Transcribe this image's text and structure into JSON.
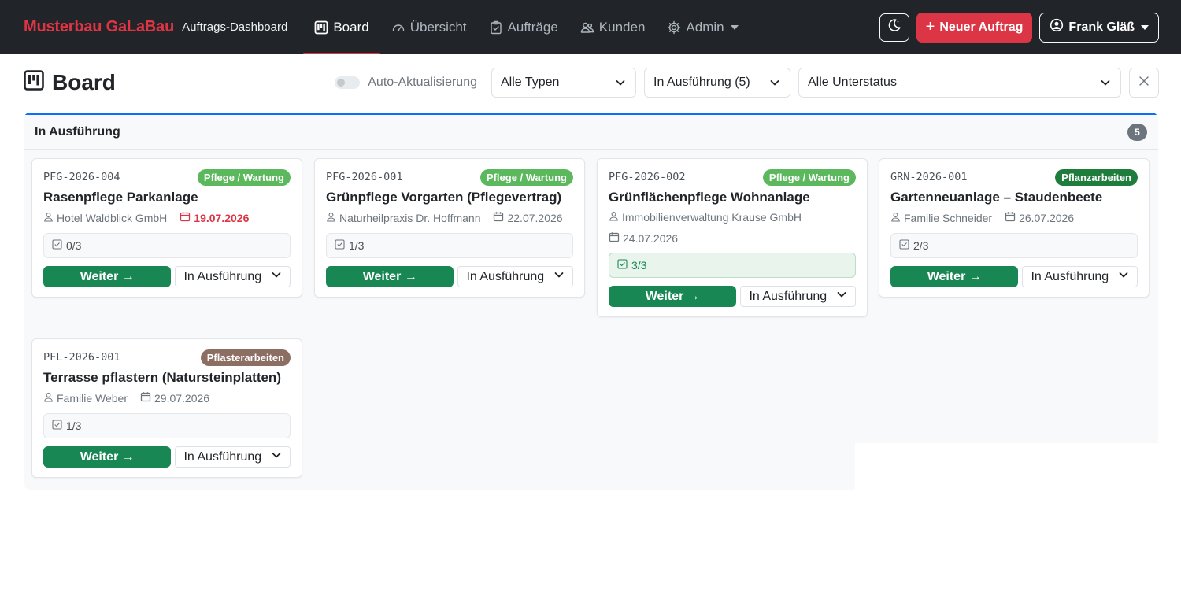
{
  "navbar": {
    "brand": "Musterbau GaLaBau",
    "subtitle": "Auftrags-Dashboard",
    "links": [
      {
        "label": "Board",
        "icon": "kanban-icon",
        "active": true
      },
      {
        "label": "Übersicht",
        "icon": "speedometer-icon",
        "active": false
      },
      {
        "label": "Aufträge",
        "icon": "clipboard-check-icon",
        "active": false
      },
      {
        "label": "Kunden",
        "icon": "people-icon",
        "active": false
      },
      {
        "label": "Admin",
        "icon": "gear-icon",
        "active": false
      }
    ],
    "new_order_label": "Neuer Auftrag",
    "user_label": "Frank Gläß"
  },
  "header": {
    "title": "Board",
    "auto_refresh_label": "Auto-Aktualisierung",
    "auto_refresh_on": false,
    "type_filter": "Alle Typen",
    "status_filter": "In Ausführung (5)",
    "substatus_filter": "Alle Unterstatus"
  },
  "column": {
    "title": "In Ausführung",
    "count": "5",
    "accent": "#0d6efd"
  },
  "colors": {
    "pflege": "#5cb85c",
    "pflanz": "#1e7d3c",
    "pflaster": "#8d6e63",
    "weiter": "#198754",
    "danger": "#dc3545"
  },
  "cards": [
    {
      "code": "PFG-2026-004",
      "type": "Pflege / Wartung",
      "title": "Rasenpflege Parkanlage",
      "customer": "Hotel Waldblick GmbH",
      "date": "19.07.2026",
      "progress": "0/3",
      "action": "Weiter →",
      "status": "In Ausführung"
    },
    {
      "code": "PFG-2026-001",
      "type": "Pflege / Wartung",
      "title": "Grünpflege Vorgarten (Pflegevertrag)",
      "customer": "Naturheilpraxis Dr. Hoffmann",
      "date": "22.07.2026",
      "progress": "1/3",
      "action": "Weiter →",
      "status": "In Ausführung"
    },
    {
      "code": "PFG-2026-002",
      "type": "Pflege / Wartung",
      "title": "Grünflächenpflege Wohnanlage",
      "customer": "Immobilienverwaltung Krause GmbH",
      "date": "24.07.2026",
      "progress": "3/3",
      "action": "Weiter →",
      "status": "In Ausführung"
    },
    {
      "code": "GRN-2026-001",
      "type": "Pflanzarbeiten",
      "title": "Gartenneuanlage – Staudenbeete",
      "customer": "Familie Schneider",
      "date": "26.07.2026",
      "progress": "2/3",
      "action": "Weiter →",
      "status": "In Ausführung"
    },
    {
      "code": "PFL-2026-001",
      "type": "Pflasterarbeiten",
      "title": "Terrasse pflastern (Natursteinplatten)",
      "customer": "Familie Weber",
      "date": "29.07.2026",
      "progress": "1/3",
      "action": "Weiter →",
      "status": "In Ausführung"
    }
  ]
}
